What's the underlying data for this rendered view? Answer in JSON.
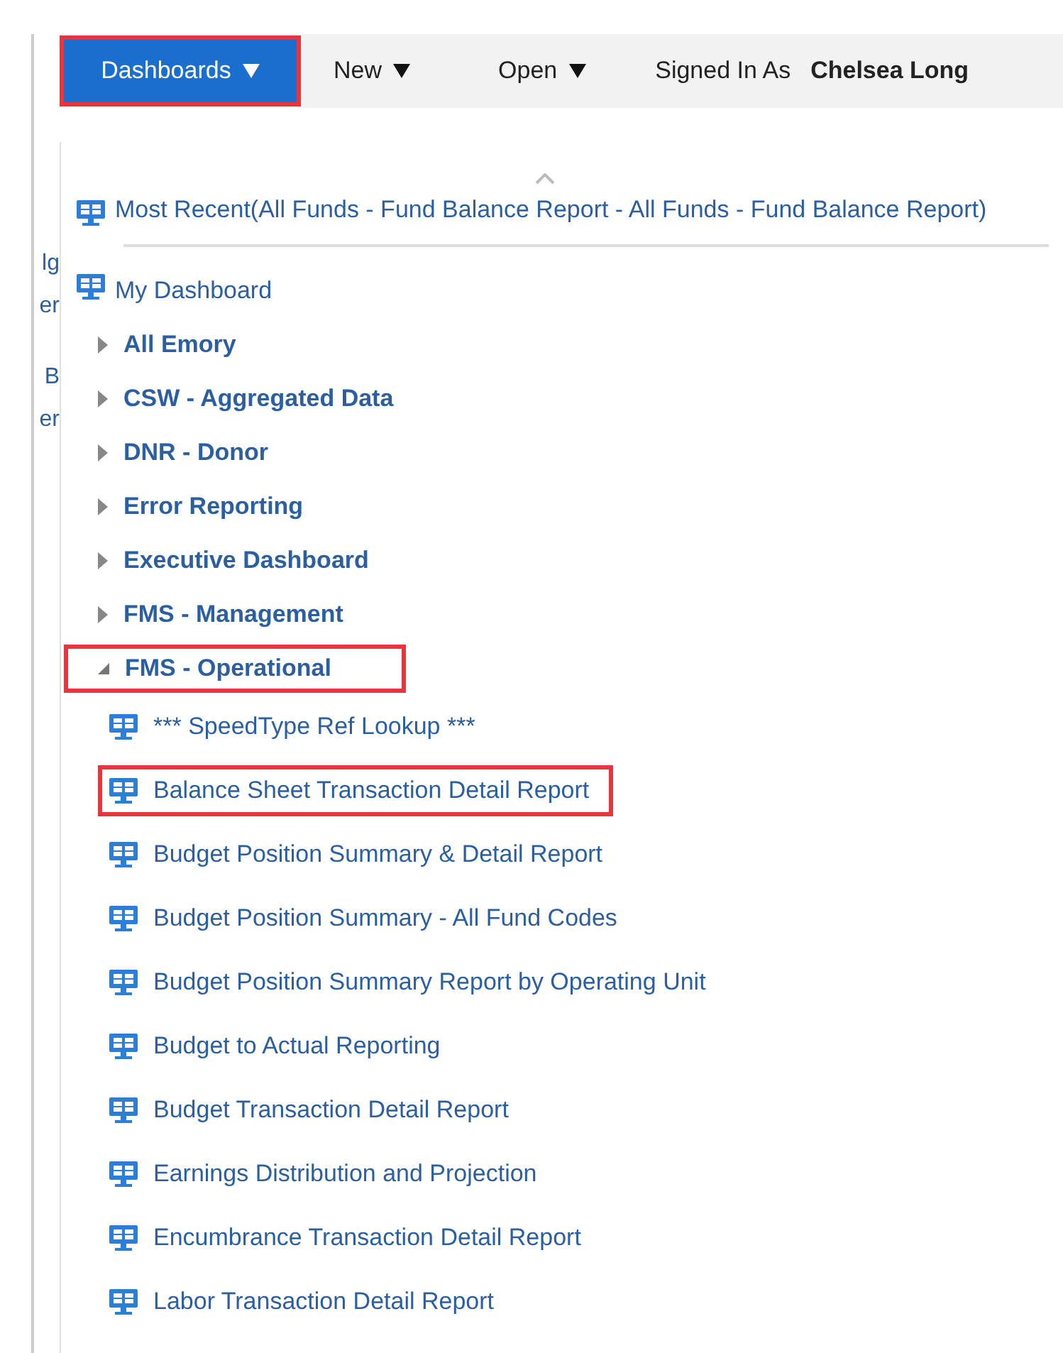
{
  "menubar": {
    "items": [
      {
        "label": "Dashboards",
        "kind": "menu",
        "selected": true,
        "highlighted": true
      },
      {
        "label": "New",
        "kind": "menu",
        "selected": false,
        "highlighted": false
      },
      {
        "label": "Open",
        "kind": "menu",
        "selected": false,
        "highlighted": false
      }
    ],
    "signed_in_label": "Signed In As",
    "user_name": "Chelsea Long"
  },
  "background_fragments": [
    "lg",
    "er",
    "B",
    "er"
  ],
  "dropdown": {
    "most_recent": "Most Recent(All Funds - Fund Balance Report - All Funds - Fund Balance Report)",
    "my_dashboard": "My Dashboard",
    "folders": [
      {
        "label": "All Emory",
        "expanded": false,
        "highlighted": false
      },
      {
        "label": "CSW - Aggregated Data",
        "expanded": false,
        "highlighted": false
      },
      {
        "label": "DNR - Donor",
        "expanded": false,
        "highlighted": false
      },
      {
        "label": "Error Reporting",
        "expanded": false,
        "highlighted": false
      },
      {
        "label": "Executive Dashboard",
        "expanded": false,
        "highlighted": false
      },
      {
        "label": "FMS - Management",
        "expanded": false,
        "highlighted": false
      },
      {
        "label": "FMS - Operational",
        "expanded": true,
        "highlighted": true,
        "children": [
          {
            "label": "*** SpeedType Ref Lookup ***",
            "highlighted": false
          },
          {
            "label": "Balance Sheet Transaction Detail Report",
            "highlighted": true
          },
          {
            "label": "Budget Position Summary & Detail Report",
            "highlighted": false
          },
          {
            "label": "Budget Position Summary - All Fund Codes",
            "highlighted": false
          },
          {
            "label": "Budget Position Summary Report by Operating Unit",
            "highlighted": false
          },
          {
            "label": "Budget to Actual Reporting",
            "highlighted": false
          },
          {
            "label": "Budget Transaction Detail Report",
            "highlighted": false
          },
          {
            "label": "Earnings Distribution and Projection",
            "highlighted": false
          },
          {
            "label": "Encumbrance Transaction Detail Report",
            "highlighted": false
          },
          {
            "label": "Labor Transaction Detail Report",
            "highlighted": false
          }
        ]
      }
    ]
  }
}
